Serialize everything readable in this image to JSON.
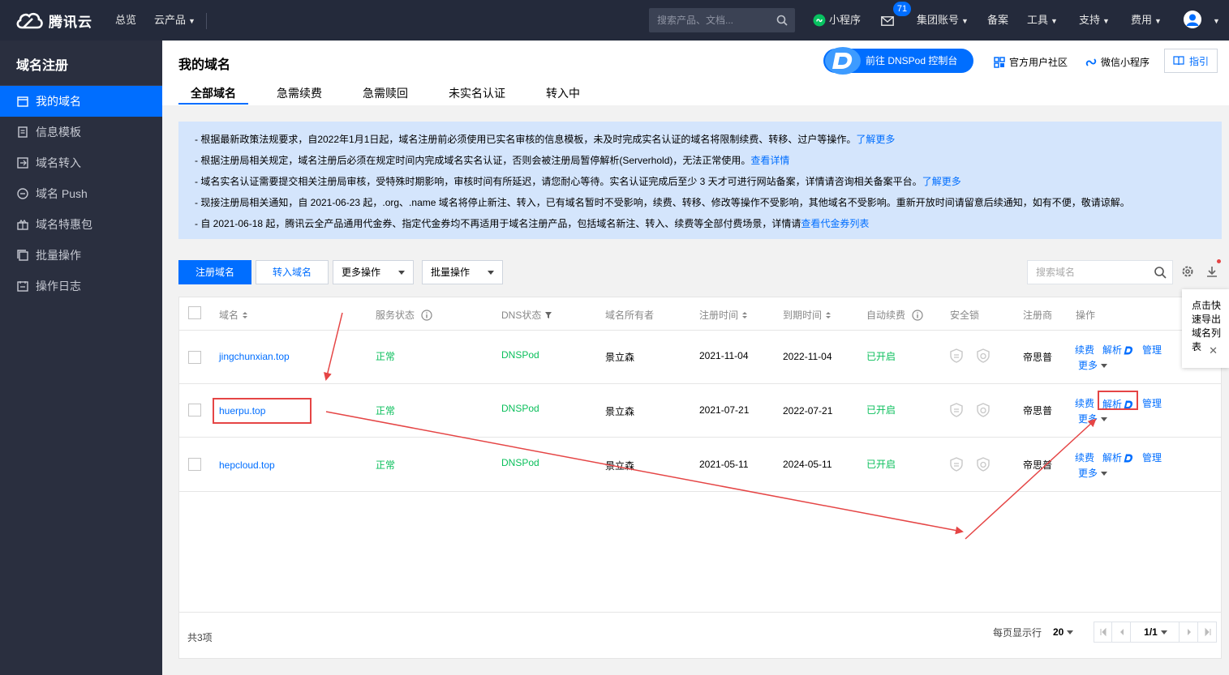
{
  "topbar": {
    "brand": "腾讯云",
    "nav_overview": "总览",
    "nav_products": "云产品",
    "search_placeholder": "搜索产品、文档...",
    "miniprogram": "小程序",
    "message_count": "71",
    "group_account": "集团账号",
    "beian": "备案",
    "tools": "工具",
    "support": "支持",
    "billing": "费用"
  },
  "sidebar": {
    "title": "域名注册",
    "items": [
      {
        "label": "我的域名",
        "icon": "calendar-icon"
      },
      {
        "label": "信息模板",
        "icon": "template-icon"
      },
      {
        "label": "域名转入",
        "icon": "transfer-icon"
      },
      {
        "label": "域名 Push",
        "icon": "push-icon"
      },
      {
        "label": "域名特惠包",
        "icon": "gift-icon"
      },
      {
        "label": "批量操作",
        "icon": "batch-icon"
      },
      {
        "label": "操作日志",
        "icon": "log-icon"
      }
    ]
  },
  "header": {
    "title": "我的域名",
    "dnspod_button": "前往 DNSPod 控制台",
    "community": "官方用户社区",
    "wechat_mini": "微信小程序",
    "guide": "指引",
    "tabs": [
      "全部域名",
      "急需续费",
      "急需赎回",
      "未实名认证",
      "转入中"
    ]
  },
  "notice": [
    {
      "text": "- 根据最新政策法规要求，自2022年1月1日起，域名注册前必须使用已实名审核的信息模板，未及时完成实名认证的域名将限制续费、转移、过户等操作。",
      "link": "了解更多"
    },
    {
      "text": "- 根据注册局相关规定，域名注册后必须在规定时间内完成域名实名认证，否则会被注册局暂停解析(Serverhold)，无法正常使用。",
      "link": "查看详情"
    },
    {
      "text": "- 域名实名认证需要提交相关注册局审核，受特殊时期影响，审核时间有所延迟，请您耐心等待。实名认证完成后至少 3 天才可进行网站备案，详情请咨询相关备案平台。",
      "link": "了解更多"
    },
    {
      "text": "- 现接注册局相关通知，自 2021-06-23 起，.org、.name 域名将停止新注、转入，已有域名暂时不受影响，续费、转移、修改等操作不受影响，其他域名不受影响。重新开放时间请留意后续通知，如有不便，敬请谅解。",
      "link": ""
    },
    {
      "text": "- 自 2021-06-18 起，腾讯云全产品通用代金券、指定代金券均不再适用于域名注册产品，包括域名新注、转入、续费等全部付费场景，详情请",
      "link": "查看代金券列表"
    }
  ],
  "toolbar": {
    "register": "注册域名",
    "transfer_in": "转入域名",
    "more_ops": "更多操作",
    "batch_ops": "批量操作",
    "search_placeholder": "搜索域名"
  },
  "tooltip": {
    "text": "点击快速导出域名列表"
  },
  "table": {
    "headers": {
      "domain": "域名",
      "status": "服务状态",
      "dns": "DNS状态",
      "owner": "域名所有者",
      "reg_time": "注册时间",
      "exp_time": "到期时间",
      "auto_renew": "自动续费",
      "lock": "安全锁",
      "registrar": "注册商",
      "ops": "操作"
    },
    "rows": [
      {
        "domain": "jingchunxian.top",
        "status": "正常",
        "dns": "DNSPod",
        "owner": "景立森",
        "reg_time": "2021-11-04",
        "exp_time": "2022-11-04",
        "auto_renew": "已开启",
        "registrar": "帝思普"
      },
      {
        "domain": "huerpu.top",
        "status": "正常",
        "dns": "DNSPod",
        "owner": "景立森",
        "reg_time": "2021-07-21",
        "exp_time": "2022-07-21",
        "auto_renew": "已开启",
        "registrar": "帝思普"
      },
      {
        "domain": "hepcloud.top",
        "status": "正常",
        "dns": "DNSPod",
        "owner": "景立森",
        "reg_time": "2021-05-11",
        "exp_time": "2024-05-11",
        "auto_renew": "已开启",
        "registrar": "帝思普"
      }
    ],
    "actions": {
      "renew": "续费",
      "resolve": "解析",
      "manage": "管理",
      "more": "更多"
    }
  },
  "footer": {
    "total": "共3项",
    "per_page_label": "每页显示行",
    "per_page_value": "20",
    "page": "1/1"
  },
  "colors": {
    "primary": "#006eff",
    "success": "#0abf5b",
    "annotation": "#e54545"
  }
}
